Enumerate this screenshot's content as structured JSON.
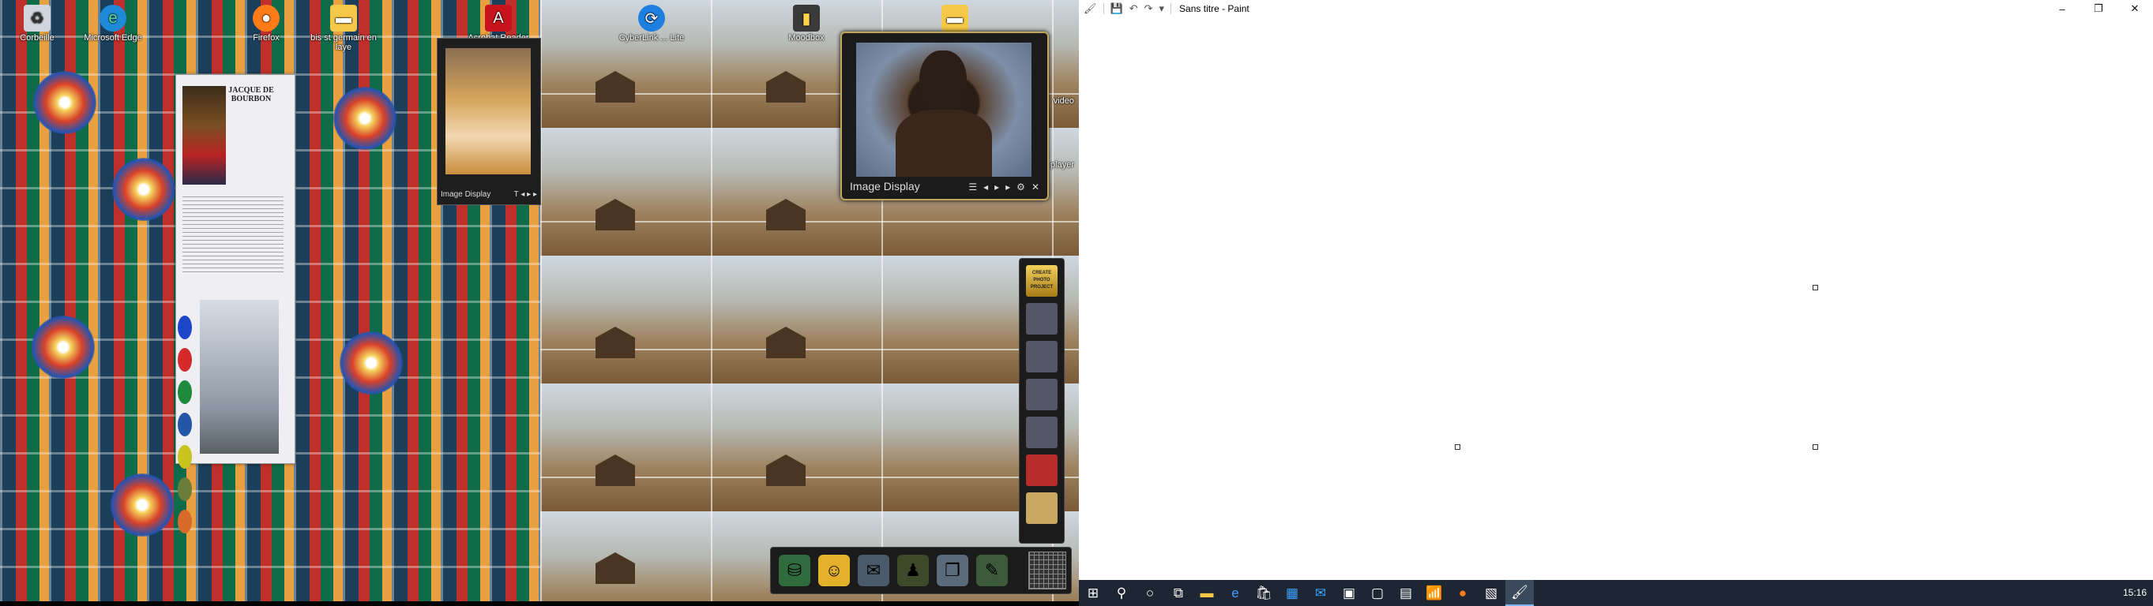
{
  "desktop": {
    "icons": [
      {
        "label": "Corbeille",
        "icon": "recycle-bin-icon"
      },
      {
        "label": "Microsoft Edge",
        "icon": "edge-icon"
      },
      {
        "label": "Firefox",
        "icon": "firefox-icon"
      },
      {
        "label": "bis st germain en laye",
        "icon": "folder-icon"
      },
      {
        "label": "Acrobat Reader DC",
        "icon": "acrobat-icon"
      },
      {
        "label": "CyberLink ... Lite",
        "icon": "cyberlink-icon"
      },
      {
        "label": "Moodbox",
        "icon": "file-icon"
      },
      {
        "label": "",
        "icon": "folder-icon"
      }
    ],
    "partial_labels": {
      "video": "video",
      "player": "player"
    },
    "document": {
      "title": "JACQUE DE BOURBON"
    },
    "small_viewer": {
      "label": "Image Display"
    },
    "image_display": {
      "label": "Image Display"
    },
    "side_dock": {
      "top_label": "CREATE PHOTO PROJECT"
    }
  },
  "paint": {
    "title": "Sans titre - Paint",
    "window_controls": {
      "minimize": "–",
      "maximize": "❐",
      "close": "✕"
    }
  },
  "taskbar": {
    "clock": "15:16",
    "active_app": "paint"
  }
}
